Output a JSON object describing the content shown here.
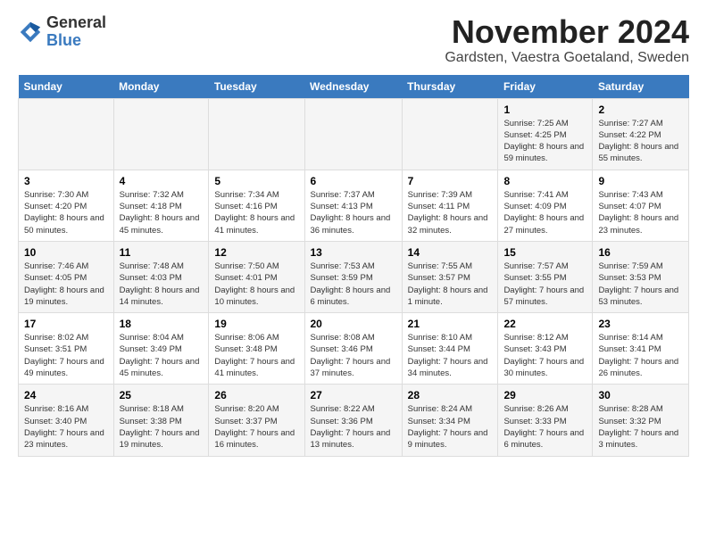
{
  "logo": {
    "general": "General",
    "blue": "Blue"
  },
  "header": {
    "month": "November 2024",
    "location": "Gardsten, Vaestra Goetaland, Sweden"
  },
  "days_of_week": [
    "Sunday",
    "Monday",
    "Tuesday",
    "Wednesday",
    "Thursday",
    "Friday",
    "Saturday"
  ],
  "weeks": [
    [
      {
        "day": "",
        "info": ""
      },
      {
        "day": "",
        "info": ""
      },
      {
        "day": "",
        "info": ""
      },
      {
        "day": "",
        "info": ""
      },
      {
        "day": "",
        "info": ""
      },
      {
        "day": "1",
        "info": "Sunrise: 7:25 AM\nSunset: 4:25 PM\nDaylight: 8 hours and 59 minutes."
      },
      {
        "day": "2",
        "info": "Sunrise: 7:27 AM\nSunset: 4:22 PM\nDaylight: 8 hours and 55 minutes."
      }
    ],
    [
      {
        "day": "3",
        "info": "Sunrise: 7:30 AM\nSunset: 4:20 PM\nDaylight: 8 hours and 50 minutes."
      },
      {
        "day": "4",
        "info": "Sunrise: 7:32 AM\nSunset: 4:18 PM\nDaylight: 8 hours and 45 minutes."
      },
      {
        "day": "5",
        "info": "Sunrise: 7:34 AM\nSunset: 4:16 PM\nDaylight: 8 hours and 41 minutes."
      },
      {
        "day": "6",
        "info": "Sunrise: 7:37 AM\nSunset: 4:13 PM\nDaylight: 8 hours and 36 minutes."
      },
      {
        "day": "7",
        "info": "Sunrise: 7:39 AM\nSunset: 4:11 PM\nDaylight: 8 hours and 32 minutes."
      },
      {
        "day": "8",
        "info": "Sunrise: 7:41 AM\nSunset: 4:09 PM\nDaylight: 8 hours and 27 minutes."
      },
      {
        "day": "9",
        "info": "Sunrise: 7:43 AM\nSunset: 4:07 PM\nDaylight: 8 hours and 23 minutes."
      }
    ],
    [
      {
        "day": "10",
        "info": "Sunrise: 7:46 AM\nSunset: 4:05 PM\nDaylight: 8 hours and 19 minutes."
      },
      {
        "day": "11",
        "info": "Sunrise: 7:48 AM\nSunset: 4:03 PM\nDaylight: 8 hours and 14 minutes."
      },
      {
        "day": "12",
        "info": "Sunrise: 7:50 AM\nSunset: 4:01 PM\nDaylight: 8 hours and 10 minutes."
      },
      {
        "day": "13",
        "info": "Sunrise: 7:53 AM\nSunset: 3:59 PM\nDaylight: 8 hours and 6 minutes."
      },
      {
        "day": "14",
        "info": "Sunrise: 7:55 AM\nSunset: 3:57 PM\nDaylight: 8 hours and 1 minute."
      },
      {
        "day": "15",
        "info": "Sunrise: 7:57 AM\nSunset: 3:55 PM\nDaylight: 7 hours and 57 minutes."
      },
      {
        "day": "16",
        "info": "Sunrise: 7:59 AM\nSunset: 3:53 PM\nDaylight: 7 hours and 53 minutes."
      }
    ],
    [
      {
        "day": "17",
        "info": "Sunrise: 8:02 AM\nSunset: 3:51 PM\nDaylight: 7 hours and 49 minutes."
      },
      {
        "day": "18",
        "info": "Sunrise: 8:04 AM\nSunset: 3:49 PM\nDaylight: 7 hours and 45 minutes."
      },
      {
        "day": "19",
        "info": "Sunrise: 8:06 AM\nSunset: 3:48 PM\nDaylight: 7 hours and 41 minutes."
      },
      {
        "day": "20",
        "info": "Sunrise: 8:08 AM\nSunset: 3:46 PM\nDaylight: 7 hours and 37 minutes."
      },
      {
        "day": "21",
        "info": "Sunrise: 8:10 AM\nSunset: 3:44 PM\nDaylight: 7 hours and 34 minutes."
      },
      {
        "day": "22",
        "info": "Sunrise: 8:12 AM\nSunset: 3:43 PM\nDaylight: 7 hours and 30 minutes."
      },
      {
        "day": "23",
        "info": "Sunrise: 8:14 AM\nSunset: 3:41 PM\nDaylight: 7 hours and 26 minutes."
      }
    ],
    [
      {
        "day": "24",
        "info": "Sunrise: 8:16 AM\nSunset: 3:40 PM\nDaylight: 7 hours and 23 minutes."
      },
      {
        "day": "25",
        "info": "Sunrise: 8:18 AM\nSunset: 3:38 PM\nDaylight: 7 hours and 19 minutes."
      },
      {
        "day": "26",
        "info": "Sunrise: 8:20 AM\nSunset: 3:37 PM\nDaylight: 7 hours and 16 minutes."
      },
      {
        "day": "27",
        "info": "Sunrise: 8:22 AM\nSunset: 3:36 PM\nDaylight: 7 hours and 13 minutes."
      },
      {
        "day": "28",
        "info": "Sunrise: 8:24 AM\nSunset: 3:34 PM\nDaylight: 7 hours and 9 minutes."
      },
      {
        "day": "29",
        "info": "Sunrise: 8:26 AM\nSunset: 3:33 PM\nDaylight: 7 hours and 6 minutes."
      },
      {
        "day": "30",
        "info": "Sunrise: 8:28 AM\nSunset: 3:32 PM\nDaylight: 7 hours and 3 minutes."
      }
    ]
  ]
}
